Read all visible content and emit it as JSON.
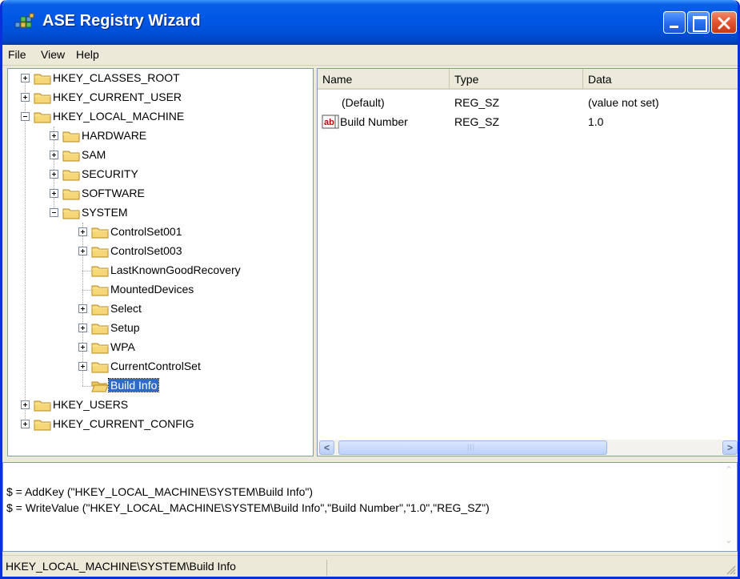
{
  "window": {
    "title": "ASE Registry Wizard",
    "colors": {
      "titlebar": "#0058e6",
      "selection": "#316ac5",
      "close": "#e2532e"
    }
  },
  "menu": [
    "File",
    "View",
    "Help"
  ],
  "tree": [
    {
      "label": "HKEY_CLASSES_ROOT"
    },
    {
      "label": "HKEY_CURRENT_USER"
    },
    {
      "label": "HKEY_LOCAL_MACHINE"
    },
    {
      "label": "HARDWARE"
    },
    {
      "label": "SAM"
    },
    {
      "label": "SECURITY"
    },
    {
      "label": "SOFTWARE"
    },
    {
      "label": "SYSTEM"
    },
    {
      "label": "ControlSet001"
    },
    {
      "label": "ControlSet003"
    },
    {
      "label": "LastKnownGoodRecovery"
    },
    {
      "label": "MountedDevices"
    },
    {
      "label": "Select"
    },
    {
      "label": "Setup"
    },
    {
      "label": "WPA"
    },
    {
      "label": "CurrentControlSet"
    },
    {
      "label": "Build Info"
    },
    {
      "label": "HKEY_USERS"
    },
    {
      "label": "HKEY_CURRENT_CONFIG"
    }
  ],
  "list": {
    "columns": [
      "Name",
      "Type",
      "Data"
    ],
    "rows": [
      {
        "name": "(Default)",
        "type": "REG_SZ",
        "data": "(value not set)",
        "icon": "none"
      },
      {
        "name": "Build Number",
        "type": "REG_SZ",
        "data": "1.0",
        "icon": "string-value-icon"
      }
    ]
  },
  "script": {
    "lines": [
      "$ = AddKey (\"HKEY_LOCAL_MACHINE\\SYSTEM\\Build Info\")",
      "$ = WriteValue (\"HKEY_LOCAL_MACHINE\\SYSTEM\\Build Info\",\"Build Number\",\"1.0\",\"REG_SZ\")"
    ]
  },
  "status": {
    "path": "HKEY_LOCAL_MACHINE\\SYSTEM\\Build Info"
  }
}
